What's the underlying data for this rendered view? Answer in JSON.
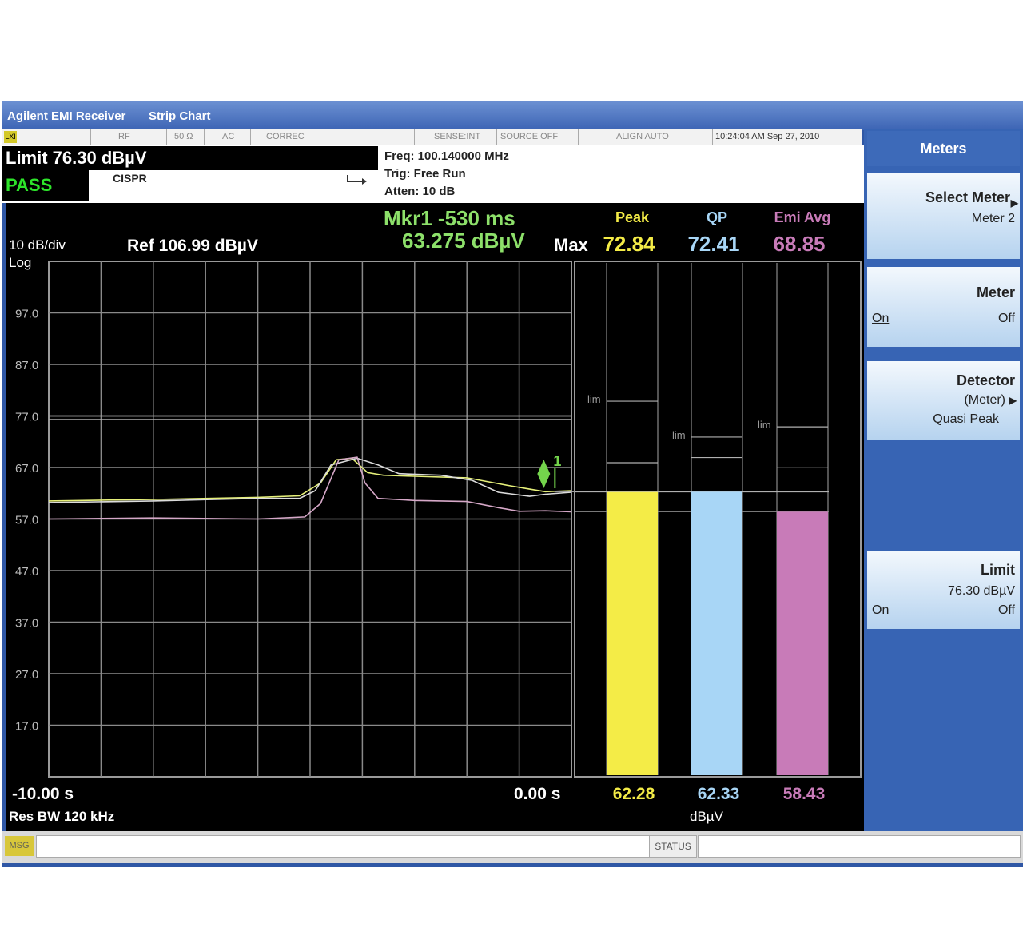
{
  "window": {
    "title_app": "Agilent EMI Receiver",
    "title_mode": "Strip Chart"
  },
  "statusbar": {
    "flag": "LXI",
    "rf": "RF",
    "impedance": "50 Ω",
    "coupling": "AC",
    "correc": "CORREC",
    "sense": "SENSE:INT",
    "source": "SOURCE OFF",
    "align": "ALIGN AUTO",
    "datetime": "10:24:04 AM Sep 27, 2010"
  },
  "info": {
    "limit": "Limit  76.30 dBµV",
    "pass": "PASS",
    "standard": "CISPR",
    "freq": "Freq: 100.140000 MHz",
    "trig": "Trig: Free Run",
    "atten": "Atten: 10 dB"
  },
  "screen": {
    "scale": "10 dB/div",
    "ref": "Ref 106.99 dBµV",
    "log": "Log",
    "marker_time": "Mkr1  -530 ms",
    "marker_value": "63.275 dBµV",
    "marker_num": "1",
    "max_label": "Max",
    "meters": [
      {
        "header": "Peak",
        "max": "72.84",
        "current": "62.28",
        "value": 62.28,
        "limit_label": "lim",
        "color": "#f4ec47"
      },
      {
        "header": "QP",
        "max": "72.41",
        "current": "62.33",
        "value": 62.33,
        "limit_label": "lim",
        "color": "#a8d6f6"
      },
      {
        "header": "Emi Avg",
        "max": "68.85",
        "current": "58.43",
        "value": 58.43,
        "limit_label": "lim",
        "color": "#c87bb8"
      }
    ],
    "unit": "dBµV",
    "x_start": "-10.00 s",
    "x_end": "0.00 s",
    "res_bw": "Res BW 120 kHz"
  },
  "chart_data": {
    "type": "line",
    "xlabel": "",
    "ylabel": "",
    "x_range": [
      -10,
      0
    ],
    "ylim": [
      7,
      107
    ],
    "y_ticks": [
      97.0,
      87.0,
      77.0,
      67.0,
      57.0,
      47.0,
      37.0,
      27.0,
      17.0
    ],
    "limit_lines": [
      76.3,
      77.0
    ],
    "grid": true,
    "series": [
      {
        "color": "#e6f07a",
        "x": [
          -10,
          -8,
          -6,
          -5.2,
          -4.8,
          -4.5,
          -4.2,
          -3.9,
          -3.6,
          -3,
          -2,
          -1.2,
          -0.8,
          -0.5,
          0
        ],
        "y": [
          60.5,
          60.8,
          61.2,
          61.5,
          64,
          68.5,
          68.8,
          66,
          65.5,
          65.3,
          65,
          63.5,
          62.8,
          62.3,
          62.5
        ]
      },
      {
        "color": "#dcdcdc",
        "x": [
          -10,
          -8,
          -6,
          -5.2,
          -4.9,
          -4.6,
          -4.1,
          -3.7,
          -3.3,
          -2.5,
          -1.9,
          -1.4,
          -0.8,
          -0.5,
          0
        ],
        "y": [
          60.2,
          60.5,
          61,
          61,
          62.5,
          67.5,
          68.8,
          67.5,
          65.8,
          65.5,
          64.5,
          62.2,
          61.4,
          61.8,
          62.2
        ]
      },
      {
        "color": "#d6a8c8",
        "x": [
          -10,
          -8,
          -6,
          -5.1,
          -4.8,
          -4.45,
          -4.1,
          -3.95,
          -3.7,
          -3,
          -2,
          -1.4,
          -1,
          -0.5,
          0
        ],
        "y": [
          57,
          57.2,
          57,
          57.4,
          60,
          68.5,
          69,
          64,
          61,
          60.6,
          60.4,
          59.2,
          58.5,
          58.6,
          58.4
        ]
      }
    ]
  },
  "softkeys": {
    "header": "Meters",
    "select_meter": "Select Meter",
    "select_meter_value": "Meter 2",
    "meter": "Meter",
    "meter_on": "On",
    "meter_off": "Off",
    "detector": "Detector",
    "detector_sub": "(Meter)",
    "detector_value": "Quasi Peak",
    "limit": "Limit",
    "limit_value": "76.30 dBµV",
    "limit_on": "On",
    "limit_off": "Off"
  },
  "msgbar": {
    "msg": "MSG",
    "status": "STATUS"
  }
}
